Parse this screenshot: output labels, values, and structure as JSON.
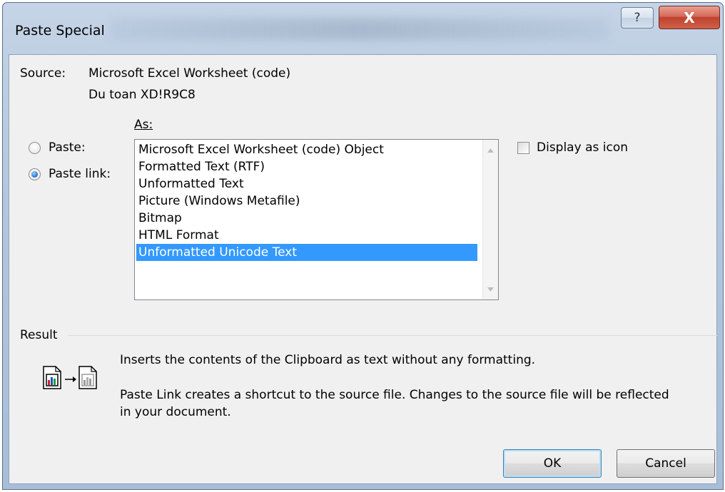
{
  "window": {
    "title": "Paste Special",
    "help_glyph": "?",
    "close_glyph": "X"
  },
  "source": {
    "label": "Source:",
    "app": "Microsoft Excel Worksheet (code)",
    "ref": "Du toan XD!R9C8"
  },
  "as_label": "As:",
  "options": {
    "paste_label": "Paste:",
    "paste_link_label": "Paste link:",
    "selected": "Paste link"
  },
  "list": {
    "items": [
      "Microsoft Excel Worksheet (code) Object",
      "Formatted Text (RTF)",
      "Unformatted Text",
      "Picture (Windows Metafile)",
      "Bitmap",
      "HTML Format",
      "Unformatted Unicode Text"
    ],
    "selected_index": 6
  },
  "display_as_icon": {
    "label": "Display as icon",
    "checked": false
  },
  "result": {
    "label": "Result",
    "line1": "Inserts the contents of the Clipboard as text without any formatting.",
    "line2": "Paste Link creates a shortcut to the source file. Changes to the source file will be reflected",
    "line3": "in your document."
  },
  "buttons": {
    "ok": "OK",
    "cancel": "Cancel"
  },
  "colors": {
    "selection": "#3399ff",
    "close_button": "#c0432f"
  }
}
